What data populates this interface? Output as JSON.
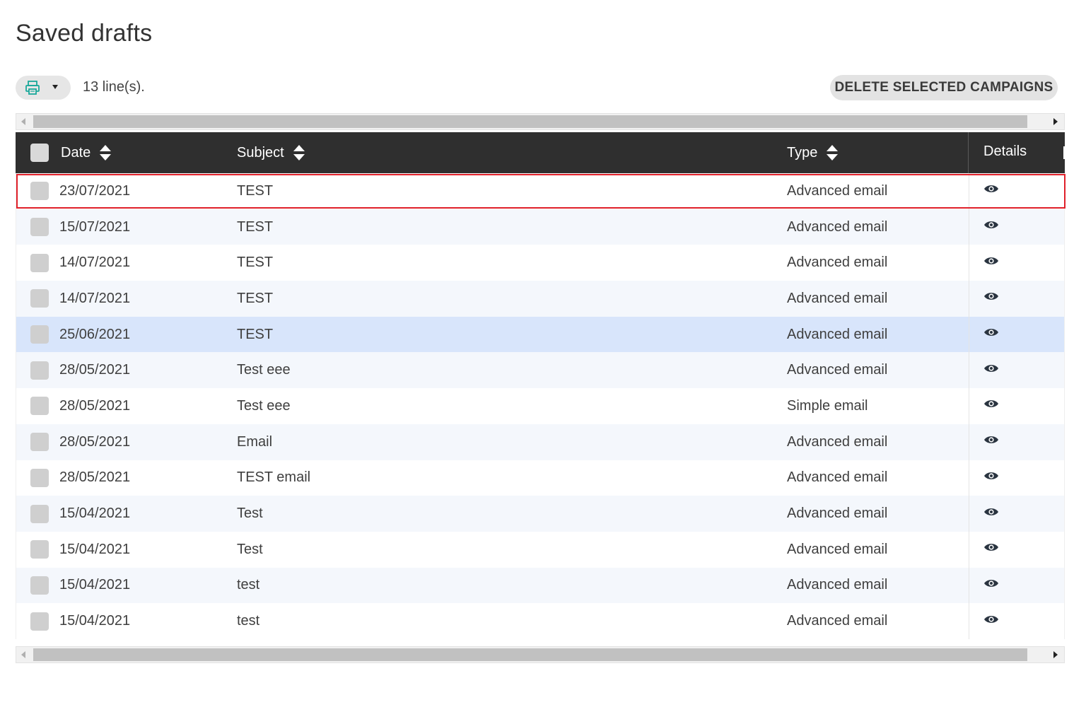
{
  "page": {
    "title": "Saved drafts"
  },
  "toolbar": {
    "line_count": "13 line(s).",
    "delete_label": "DELETE SELECTED CAMPAIGNS",
    "printer_icon": "printer-icon",
    "export_caret_icon": "caret-down-icon"
  },
  "table": {
    "headers": {
      "date": "Date",
      "subject": "Subject",
      "type": "Type",
      "details": "Details"
    },
    "rows": [
      {
        "date": "23/07/2021",
        "subject": "TEST",
        "type": "Advanced email"
      },
      {
        "date": "15/07/2021",
        "subject": "TEST",
        "type": "Advanced email"
      },
      {
        "date": "14/07/2021",
        "subject": "TEST",
        "type": "Advanced email"
      },
      {
        "date": "14/07/2021",
        "subject": "TEST",
        "type": "Advanced email"
      },
      {
        "date": "25/06/2021",
        "subject": "TEST",
        "type": "Advanced email"
      },
      {
        "date": "28/05/2021",
        "subject": "Test eee",
        "type": "Advanced email"
      },
      {
        "date": "28/05/2021",
        "subject": "Test eee",
        "type": "Simple email"
      },
      {
        "date": "28/05/2021",
        "subject": "Email",
        "type": "Advanced email"
      },
      {
        "date": "28/05/2021",
        "subject": "TEST email",
        "type": "Advanced email"
      },
      {
        "date": "15/04/2021",
        "subject": "Test",
        "type": "Advanced email"
      },
      {
        "date": "15/04/2021",
        "subject": "Test",
        "type": "Advanced email"
      },
      {
        "date": "15/04/2021",
        "subject": "test",
        "type": "Advanced email"
      },
      {
        "date": "15/04/2021",
        "subject": "test",
        "type": "Advanced email"
      }
    ],
    "hovered_row_index": 4,
    "highlighted_row_index": 0
  },
  "colors": {
    "header_bg": "#2f2f2f",
    "row_alt_bg": "#f4f7fc",
    "row_hover_bg": "#d8e5fb",
    "highlight_border": "#e0202a",
    "printer_accent": "#1aa89a"
  }
}
